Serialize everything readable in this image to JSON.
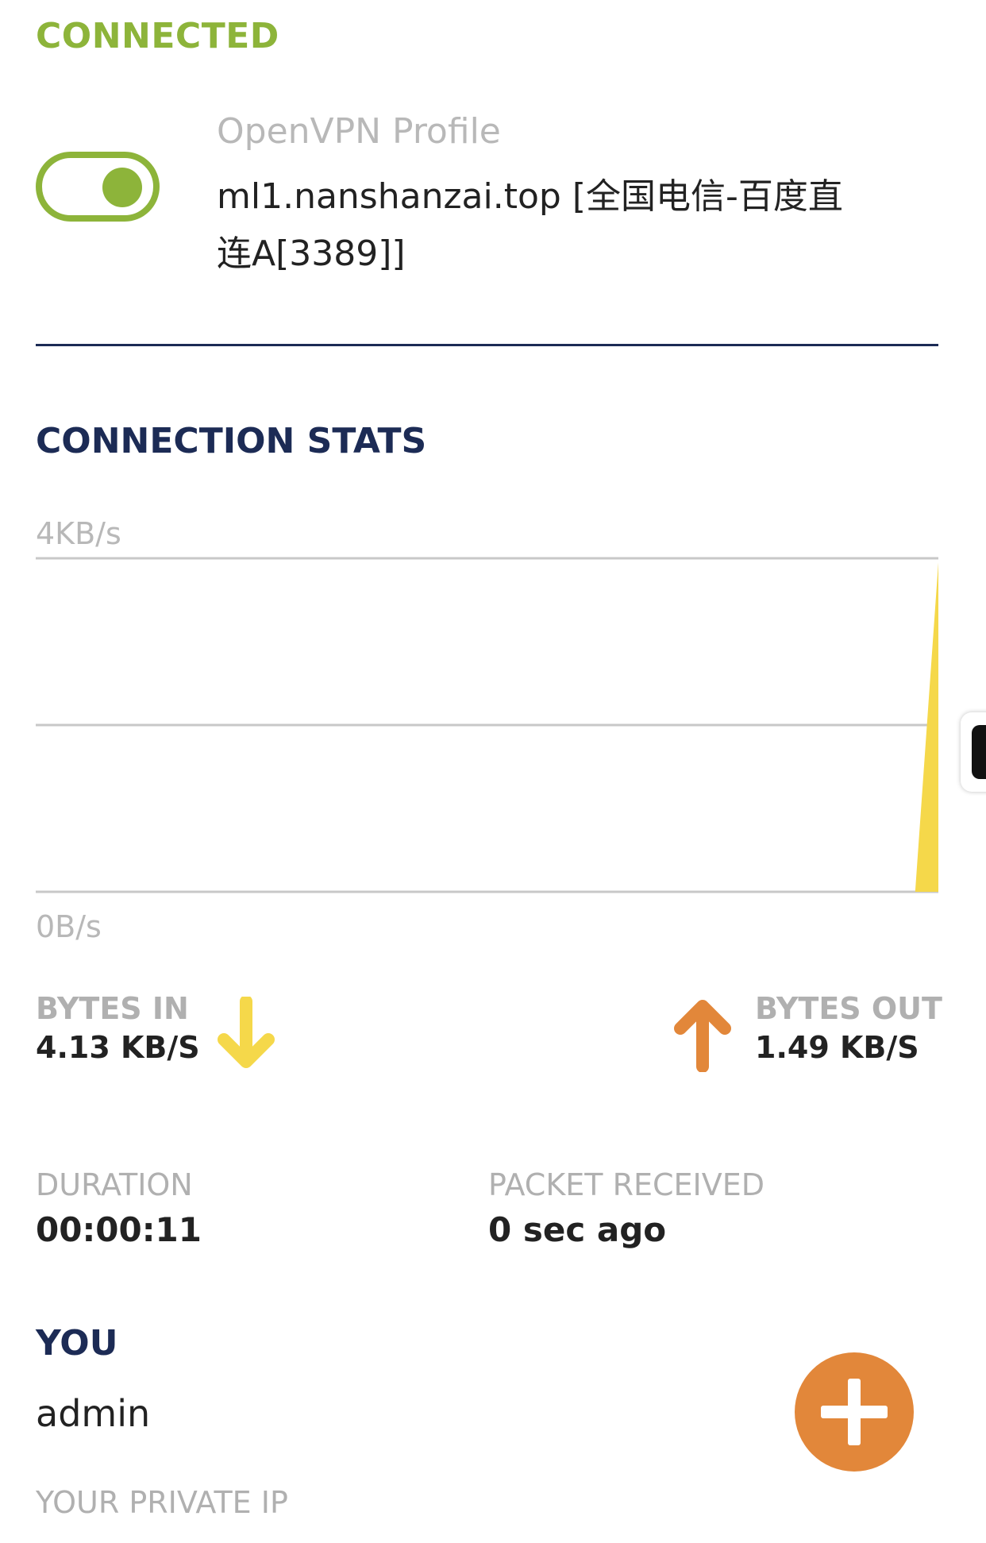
{
  "status": {
    "text": "CONNECTED",
    "color": "#8db43a"
  },
  "toggle": {
    "state": "on"
  },
  "profile": {
    "label": "OpenVPN Profile",
    "name": "ml1.nanshanzai.top [全国电信-百度直连A[3389]]"
  },
  "stats": {
    "title": "CONNECTION STATS",
    "chart_data": {
      "type": "area",
      "y_max_label": "4KB/s",
      "y_min_label": "0B/s",
      "ylim": [
        0,
        4
      ],
      "y_unit": "KB/s",
      "grid": true,
      "series": [
        {
          "color": "#f5d84a",
          "values": [
            0,
            0,
            0,
            0,
            0,
            0,
            0,
            0,
            0,
            0,
            0,
            0,
            0,
            0,
            0,
            0,
            0,
            0,
            0,
            0,
            0,
            0,
            0,
            0,
            0,
            0,
            0,
            0,
            0,
            0,
            0,
            0,
            0,
            0,
            0,
            0,
            0,
            0,
            0,
            3.95
          ]
        }
      ]
    },
    "bytes_in": {
      "label": "BYTES IN",
      "value": "4.13 KB/S",
      "icon": "arrow-down-icon",
      "color": "#f5d84a"
    },
    "bytes_out": {
      "label": "BYTES OUT",
      "value": "1.49 KB/S",
      "icon": "arrow-up-icon",
      "color": "#e2873a"
    }
  },
  "duration": {
    "label": "DURATION",
    "value": "00:00:11"
  },
  "packet_received": {
    "label": "PACKET RECEIVED",
    "value": "0 sec ago"
  },
  "you": {
    "title": "YOU",
    "user": "admin",
    "private_ip_label": "YOUR PRIVATE IP"
  },
  "fab": {
    "icon": "plus-icon",
    "color": "#e2873a"
  }
}
